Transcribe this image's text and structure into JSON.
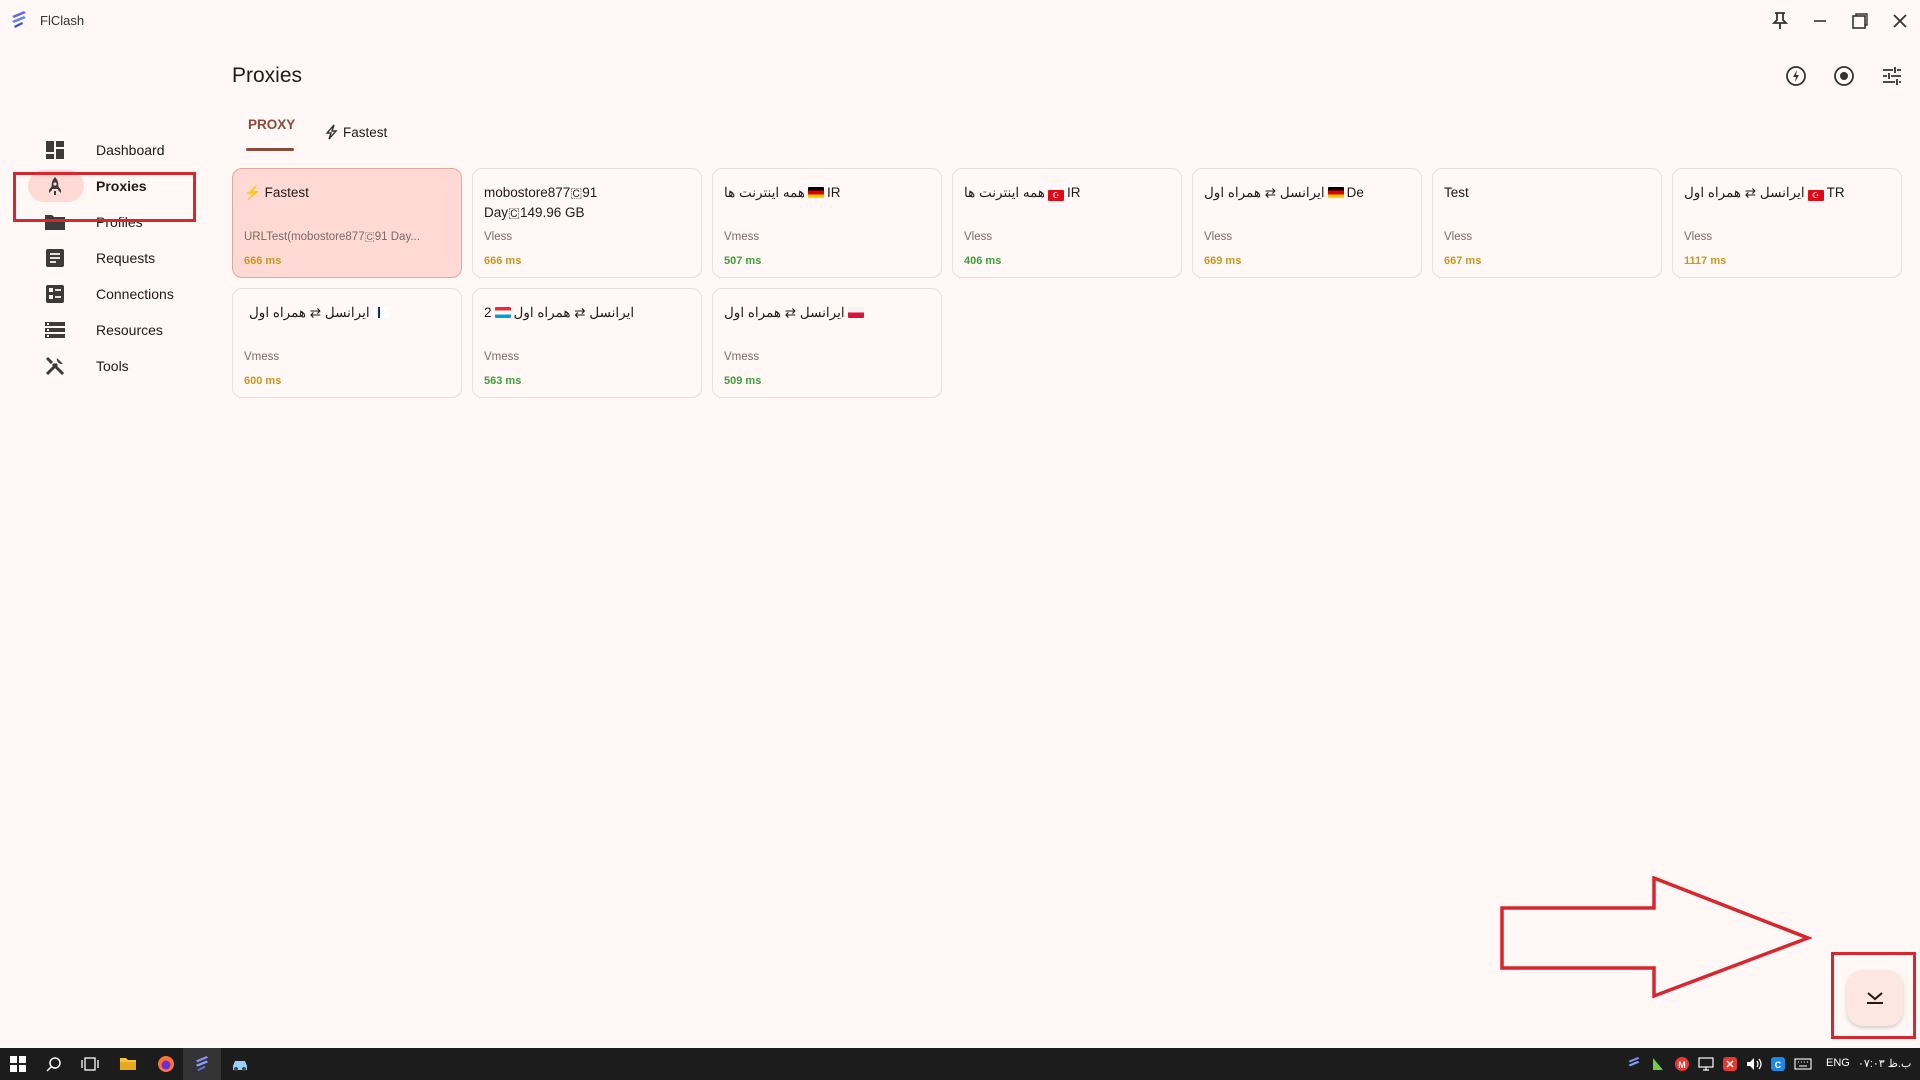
{
  "app": {
    "title": "FlClash"
  },
  "page": {
    "title": "Proxies"
  },
  "tabs": [
    {
      "label": "PROXY"
    },
    {
      "label": "Fastest"
    }
  ],
  "sidebar": {
    "items": [
      {
        "label": "Dashboard",
        "icon": "dashboard-icon"
      },
      {
        "label": "Proxies",
        "icon": "rocket-icon"
      },
      {
        "label": "Profiles",
        "icon": "folder-icon"
      },
      {
        "label": "Requests",
        "icon": "article-icon"
      },
      {
        "label": "Connections",
        "icon": "list-alt-icon"
      },
      {
        "label": "Resources",
        "icon": "storage-icon"
      },
      {
        "label": "Tools",
        "icon": "tools-icon"
      }
    ]
  },
  "cards": [
    {
      "name": "Fastest",
      "type": "URLTest(mobostore877🇨91 Day...",
      "delay": "666 ms",
      "delay_level": "yellow"
    },
    {
      "name": "mobostore877🇨91\nDay🇨149.96 GB",
      "type": "Vless",
      "delay": "666 ms",
      "delay_level": "yellow"
    },
    {
      "name": "همه اینترنت ها",
      "suffix": "IR",
      "flag": "de",
      "type": "Vmess",
      "delay": "507 ms",
      "delay_level": "green"
    },
    {
      "name": "همه اینترنت ها",
      "suffix": "IR",
      "flag": "tr",
      "type": "Vless",
      "delay": "406 ms",
      "delay_level": "green"
    },
    {
      "name": "ایرانسل ⇄ همراه اول",
      "suffix": "De",
      "flag": "de",
      "type": "Vless",
      "delay": "669 ms",
      "delay_level": "yellow"
    },
    {
      "name": "Test",
      "type": "Vless",
      "delay": "667 ms",
      "delay_level": "yellow"
    },
    {
      "name": "ایرانسل ⇄ همراه اول",
      "suffix": "TR",
      "flag": "tr",
      "type": "Vless",
      "delay": "1117 ms",
      "delay_level": "yellow"
    },
    {
      "name": "ایرانسل ⇄ همراه اول",
      "flag": "fi",
      "type": "Vmess",
      "delay": "600 ms",
      "delay_level": "yellow"
    },
    {
      "name": "ایرانسل ⇄ همراه اول",
      "suffix": "2",
      "flag": "lu",
      "type": "Vmess",
      "delay": "563 ms",
      "delay_level": "green"
    },
    {
      "name": "ایرانسل ⇄ همراه اول",
      "flag": "pl",
      "type": "Vmess",
      "delay": "509 ms",
      "delay_level": "green"
    }
  ],
  "taskbar": {
    "language": "ENG",
    "clock": "ب.ظ ۰۷:۰۳"
  },
  "colors": {
    "accent": "#8c4a3d",
    "selected_bg": "#ffdad4",
    "annotation": "#d8262e",
    "delay_green": "#3f9f3b",
    "delay_yellow": "#c49a1e"
  }
}
